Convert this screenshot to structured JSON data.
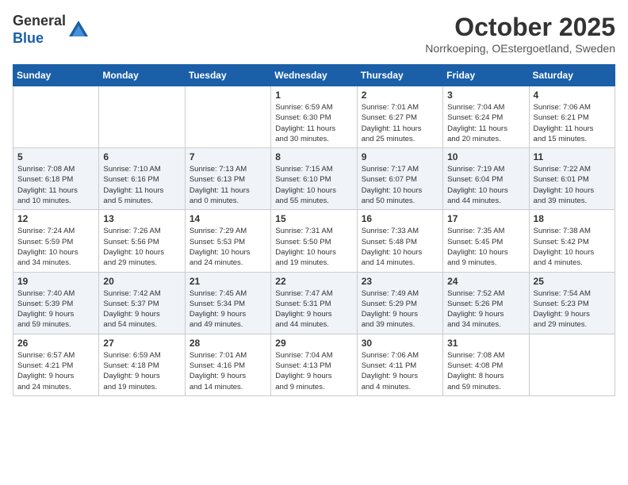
{
  "logo": {
    "general": "General",
    "blue": "Blue"
  },
  "header": {
    "month": "October 2025",
    "location": "Norrkoeping, OEstergoetland, Sweden"
  },
  "weekdays": [
    "Sunday",
    "Monday",
    "Tuesday",
    "Wednesday",
    "Thursday",
    "Friday",
    "Saturday"
  ],
  "weeks": [
    [
      {
        "day": "",
        "info": ""
      },
      {
        "day": "",
        "info": ""
      },
      {
        "day": "",
        "info": ""
      },
      {
        "day": "1",
        "info": "Sunrise: 6:59 AM\nSunset: 6:30 PM\nDaylight: 11 hours\nand 30 minutes."
      },
      {
        "day": "2",
        "info": "Sunrise: 7:01 AM\nSunset: 6:27 PM\nDaylight: 11 hours\nand 25 minutes."
      },
      {
        "day": "3",
        "info": "Sunrise: 7:04 AM\nSunset: 6:24 PM\nDaylight: 11 hours\nand 20 minutes."
      },
      {
        "day": "4",
        "info": "Sunrise: 7:06 AM\nSunset: 6:21 PM\nDaylight: 11 hours\nand 15 minutes."
      }
    ],
    [
      {
        "day": "5",
        "info": "Sunrise: 7:08 AM\nSunset: 6:18 PM\nDaylight: 11 hours\nand 10 minutes."
      },
      {
        "day": "6",
        "info": "Sunrise: 7:10 AM\nSunset: 6:16 PM\nDaylight: 11 hours\nand 5 minutes."
      },
      {
        "day": "7",
        "info": "Sunrise: 7:13 AM\nSunset: 6:13 PM\nDaylight: 11 hours\nand 0 minutes."
      },
      {
        "day": "8",
        "info": "Sunrise: 7:15 AM\nSunset: 6:10 PM\nDaylight: 10 hours\nand 55 minutes."
      },
      {
        "day": "9",
        "info": "Sunrise: 7:17 AM\nSunset: 6:07 PM\nDaylight: 10 hours\nand 50 minutes."
      },
      {
        "day": "10",
        "info": "Sunrise: 7:19 AM\nSunset: 6:04 PM\nDaylight: 10 hours\nand 44 minutes."
      },
      {
        "day": "11",
        "info": "Sunrise: 7:22 AM\nSunset: 6:01 PM\nDaylight: 10 hours\nand 39 minutes."
      }
    ],
    [
      {
        "day": "12",
        "info": "Sunrise: 7:24 AM\nSunset: 5:59 PM\nDaylight: 10 hours\nand 34 minutes."
      },
      {
        "day": "13",
        "info": "Sunrise: 7:26 AM\nSunset: 5:56 PM\nDaylight: 10 hours\nand 29 minutes."
      },
      {
        "day": "14",
        "info": "Sunrise: 7:29 AM\nSunset: 5:53 PM\nDaylight: 10 hours\nand 24 minutes."
      },
      {
        "day": "15",
        "info": "Sunrise: 7:31 AM\nSunset: 5:50 PM\nDaylight: 10 hours\nand 19 minutes."
      },
      {
        "day": "16",
        "info": "Sunrise: 7:33 AM\nSunset: 5:48 PM\nDaylight: 10 hours\nand 14 minutes."
      },
      {
        "day": "17",
        "info": "Sunrise: 7:35 AM\nSunset: 5:45 PM\nDaylight: 10 hours\nand 9 minutes."
      },
      {
        "day": "18",
        "info": "Sunrise: 7:38 AM\nSunset: 5:42 PM\nDaylight: 10 hours\nand 4 minutes."
      }
    ],
    [
      {
        "day": "19",
        "info": "Sunrise: 7:40 AM\nSunset: 5:39 PM\nDaylight: 9 hours\nand 59 minutes."
      },
      {
        "day": "20",
        "info": "Sunrise: 7:42 AM\nSunset: 5:37 PM\nDaylight: 9 hours\nand 54 minutes."
      },
      {
        "day": "21",
        "info": "Sunrise: 7:45 AM\nSunset: 5:34 PM\nDaylight: 9 hours\nand 49 minutes."
      },
      {
        "day": "22",
        "info": "Sunrise: 7:47 AM\nSunset: 5:31 PM\nDaylight: 9 hours\nand 44 minutes."
      },
      {
        "day": "23",
        "info": "Sunrise: 7:49 AM\nSunset: 5:29 PM\nDaylight: 9 hours\nand 39 minutes."
      },
      {
        "day": "24",
        "info": "Sunrise: 7:52 AM\nSunset: 5:26 PM\nDaylight: 9 hours\nand 34 minutes."
      },
      {
        "day": "25",
        "info": "Sunrise: 7:54 AM\nSunset: 5:23 PM\nDaylight: 9 hours\nand 29 minutes."
      }
    ],
    [
      {
        "day": "26",
        "info": "Sunrise: 6:57 AM\nSunset: 4:21 PM\nDaylight: 9 hours\nand 24 minutes."
      },
      {
        "day": "27",
        "info": "Sunrise: 6:59 AM\nSunset: 4:18 PM\nDaylight: 9 hours\nand 19 minutes."
      },
      {
        "day": "28",
        "info": "Sunrise: 7:01 AM\nSunset: 4:16 PM\nDaylight: 9 hours\nand 14 minutes."
      },
      {
        "day": "29",
        "info": "Sunrise: 7:04 AM\nSunset: 4:13 PM\nDaylight: 9 hours\nand 9 minutes."
      },
      {
        "day": "30",
        "info": "Sunrise: 7:06 AM\nSunset: 4:11 PM\nDaylight: 9 hours\nand 4 minutes."
      },
      {
        "day": "31",
        "info": "Sunrise: 7:08 AM\nSunset: 4:08 PM\nDaylight: 8 hours\nand 59 minutes."
      },
      {
        "day": "",
        "info": ""
      }
    ]
  ]
}
